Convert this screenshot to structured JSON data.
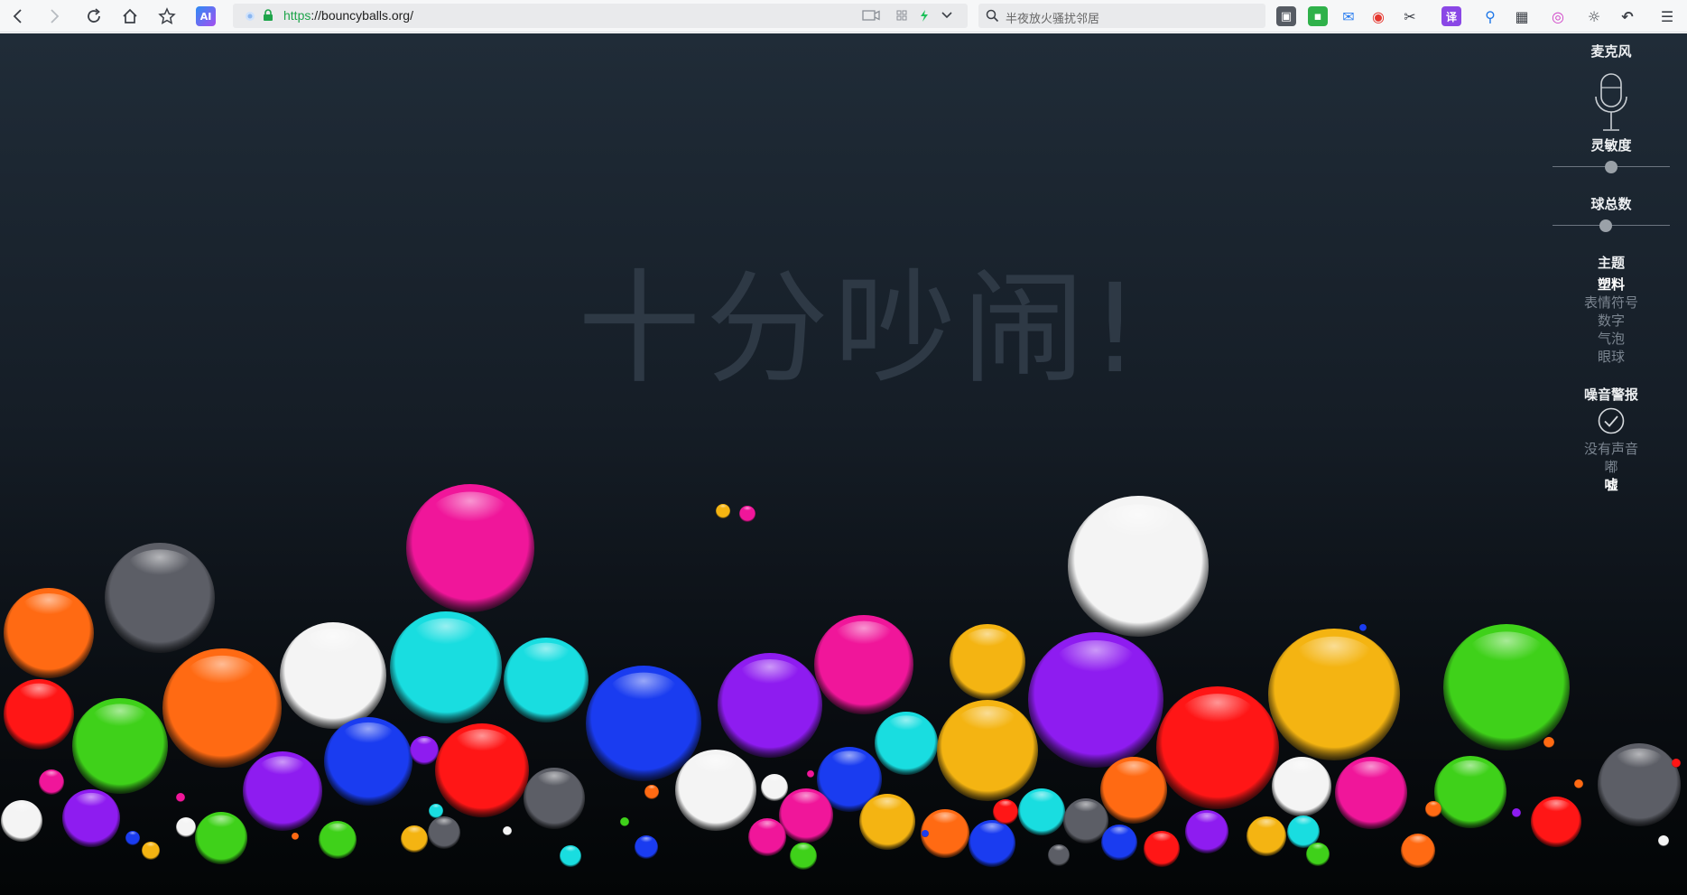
{
  "browser": {
    "url_scheme": "https",
    "url_rest": "://bouncyballs.org/",
    "search_placeholder": "半夜放火骚扰邻居"
  },
  "page": {
    "headline": "十分吵闹!"
  },
  "panel": {
    "microphone_label": "麦克风",
    "sensitivity_label": "灵敏度",
    "sensitivity_value": 0.5,
    "ball_count_label": "球总数",
    "ball_count_value": 0.45,
    "theme_label": "主题",
    "themes": [
      {
        "label": "塑料",
        "active": true
      },
      {
        "label": "表情符号",
        "active": false
      },
      {
        "label": "数字",
        "active": false
      },
      {
        "label": "气泡",
        "active": false
      },
      {
        "label": "眼球",
        "active": false
      }
    ],
    "noise_alarm_label": "噪音警报",
    "alarm_options": [
      {
        "label": "没有声音",
        "active": false
      },
      {
        "label": "嘟",
        "active": false
      },
      {
        "label": "嘘",
        "active": true
      }
    ]
  },
  "colors": {
    "orange": "#ff6a13",
    "red": "#ff1616",
    "green": "#3fd11a",
    "gray": "#5c5e66",
    "white": "#f4f4f4",
    "cyan": "#19dde0",
    "blue": "#1a3cf0",
    "purple": "#8e1cf0",
    "pink": "#f0169a",
    "yellow": "#f4b412"
  }
}
